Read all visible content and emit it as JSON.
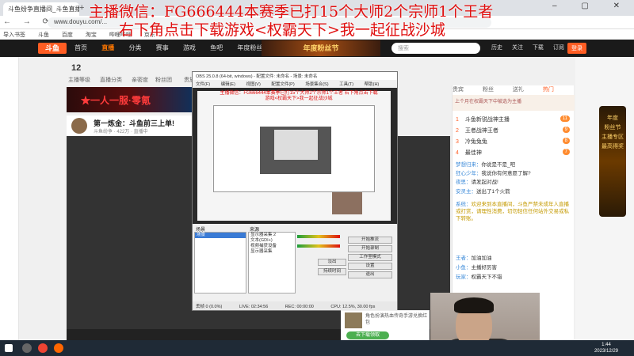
{
  "browser": {
    "tab_title": "斗鱼纷争直播间_斗鱼直播_虎",
    "url": "www.douyu.com/...",
    "bookmarks": [
      "导入书签",
      "斗鱼",
      "百度",
      "淘宝",
      "哔哩哔哩",
      "京东"
    ]
  },
  "overlay": {
    "line1": "主播微信：FG666444本赛季已打15个大师2个宗师1个王者",
    "line2": "右下角点击下载游戏<权霸天下>我一起征战沙城"
  },
  "douyu": {
    "logo": "斗鱼",
    "nav": [
      "首页",
      "直播",
      "分类",
      "赛事",
      "游戏",
      "鱼吧",
      "年度粉丝节"
    ],
    "banner": "年度粉丝节",
    "search_placeholder": "搜索",
    "right_items": [
      "历史",
      "关注",
      "下载",
      "订阅",
      "创作"
    ],
    "login": "登录"
  },
  "room": {
    "stat_num": "12",
    "stat_labels": [
      "主播等级",
      "直播分类",
      "亲密度",
      "粉丝团",
      "贵族",
      "徽章"
    ],
    "promo": "★一人一服·零氪",
    "title": "第一炼金：斗鱼前三上单!",
    "subtitle": "斗鱼纷争 · 422万 · 直播中"
  },
  "chat": {
    "tabs": [
      "贵宾",
      "粉丝",
      "送礼",
      "热门"
    ],
    "ad": "上个月在权霸天下中被选为主播",
    "ranks": [
      {
        "no": "1",
        "name": "斗鱼新锐战神主播",
        "badge": "11"
      },
      {
        "no": "2",
        "name": "王者战神王者",
        "badge": "9"
      },
      {
        "no": "3",
        "name": "冷兔兔兔",
        "badge": "8"
      },
      {
        "no": "4",
        "name": "最佳神",
        "badge": "7"
      }
    ],
    "messages": [
      {
        "name": "梦想归来：",
        "text": "你说是不是_吧"
      },
      {
        "name": "狂心少年：",
        "text": "我说你有何意愿了解?"
      },
      {
        "name": "夜思：",
        "text": "请发起对战!"
      },
      {
        "name": "安灵主：",
        "text": "送出了1个火箭"
      },
      {
        "name": "系统：",
        "text": "欢迎来到本直播间，斗鱼严禁未成年人直播或打赏，请理性消费，切勿轻信任何站外交易或私下转账。"
      },
      {
        "name": "王者：",
        "text": "加油加油"
      },
      {
        "name": "小鱼：",
        "text": "主播好厉害"
      },
      {
        "name": "玩家：",
        "text": "权霸天下不错"
      }
    ]
  },
  "obs": {
    "title": "OBS 25.0.8 (64-bit, windows) - 配置文件: 未命名 - 场景: 未命名",
    "menu": [
      "文件(F)",
      "编辑(E)",
      "视图(V)",
      "配置文件(P)",
      "场景集合(S)",
      "工具(T)",
      "帮助(H)"
    ],
    "nested_text": "主播微信：FG666444本赛季已打15个大师2个宗师1个王者 右下角点击下载游戏<权霸天下>我一起征战沙城",
    "scenes_label": "场景",
    "scenes": [
      "场景"
    ],
    "sources_label": "来源",
    "sources": [
      "显示器采集 2",
      "文本(GDI+)",
      "视频捕获设备",
      "显示器采集"
    ],
    "buttons": [
      "开始推流",
      "开始录制",
      "工作室模式",
      "设置",
      "退出"
    ],
    "mid_buttons": [
      "淡出",
      "持续时间"
    ],
    "status": [
      "丢帧 0 (0.0%)",
      "LIVE: 02:34:56",
      "REC: 00:00:00",
      "CPU: 12.5%, 30.00 fps"
    ]
  },
  "shop": {
    "text": "角色扮演热血传奇手游兑换红包",
    "button": "去下载领取"
  },
  "taskbar": {
    "time": "1:44",
    "date": "2023/12/29"
  },
  "year_box": {
    "line1": "年度",
    "line2": "粉丝节",
    "line3": "主播专区",
    "line4": "最高得奖"
  }
}
